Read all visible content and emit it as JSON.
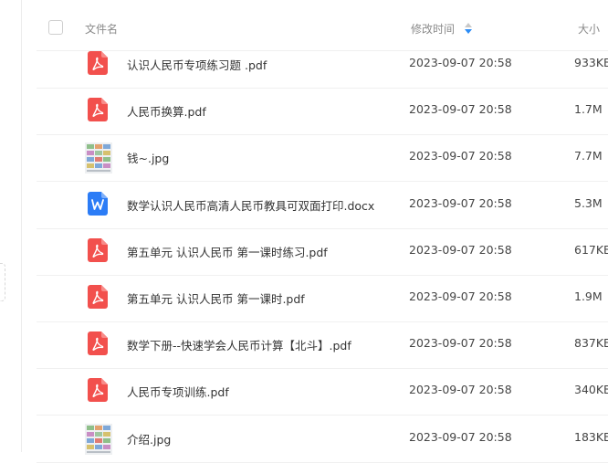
{
  "header": {
    "name_label": "文件名",
    "time_label": "修改时间",
    "size_label": "大小"
  },
  "colors": {
    "pdf_red": "#f2504d",
    "word_blue": "#2b7cf6",
    "sort_active": "#2b8cf6",
    "divider": "#f0f0f0"
  },
  "files": [
    {
      "name": "认识人民币专项练习题 .pdf",
      "time": "2023-09-07 20:58",
      "size": "933KB",
      "icon": "pdf-icon"
    },
    {
      "name": "人民币换算.pdf",
      "time": "2023-09-07 20:58",
      "size": "1.7M",
      "icon": "pdf-icon"
    },
    {
      "name": "钱~.jpg",
      "time": "2023-09-07 20:58",
      "size": "7.7M",
      "icon": "image-thumbnail-icon"
    },
    {
      "name": "数学认识人民币高清人民币教具可双面打印.docx",
      "time": "2023-09-07 20:58",
      "size": "5.3M",
      "icon": "word-doc-icon"
    },
    {
      "name": "第五单元 认识人民币 第一课时练习.pdf",
      "time": "2023-09-07 20:58",
      "size": "617KB",
      "icon": "pdf-icon"
    },
    {
      "name": "第五单元 认识人民币 第一课时.pdf",
      "time": "2023-09-07 20:58",
      "size": "1.9M",
      "icon": "pdf-icon"
    },
    {
      "name": "数学下册--快速学会人民币计算【北斗】.pdf",
      "time": "2023-09-07 20:58",
      "size": "837KB",
      "icon": "pdf-icon"
    },
    {
      "name": "人民币专项训练.pdf",
      "time": "2023-09-07 20:58",
      "size": "340KB",
      "icon": "pdf-icon"
    },
    {
      "name": "介绍.jpg",
      "time": "2023-09-07 20:58",
      "size": "183KB",
      "icon": "image-thumbnail-icon"
    }
  ]
}
